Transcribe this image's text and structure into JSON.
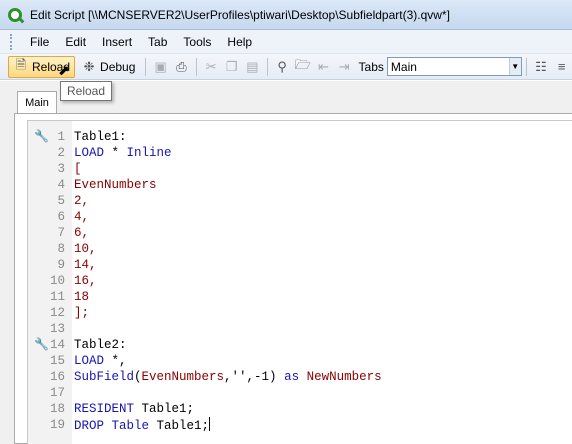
{
  "window": {
    "title": "Edit Script [\\\\MCNSERVER2\\UserProfiles\\ptiwari\\Desktop\\Subfieldpart(3).qvw*]"
  },
  "menu": [
    "File",
    "Edit",
    "Insert",
    "Tab",
    "Tools",
    "Help"
  ],
  "toolbar": {
    "reload_label": "Reload",
    "debug_label": "Debug",
    "tabs_label": "Tabs",
    "tabs_selected": "Main",
    "icons": [
      "save-icon",
      "print-icon",
      "cut-icon",
      "copy-icon",
      "paste-icon",
      "search-icon",
      "folder-icon",
      "outdent-icon",
      "indent-icon",
      "table-viewer-icon",
      "expand-icon"
    ]
  },
  "tooltip": {
    "text": "Reload"
  },
  "tab": {
    "label": "Main"
  },
  "editor": {
    "lines": [
      {
        "n": "1",
        "pin": true,
        "tokens": [
          {
            "t": "Table1:",
            "c": "txt"
          }
        ]
      },
      {
        "n": "2",
        "tokens": [
          {
            "t": "LOAD",
            "c": "kw"
          },
          {
            "t": " * ",
            "c": "txt"
          },
          {
            "t": "Inline",
            "c": "kw"
          }
        ]
      },
      {
        "n": "3",
        "tokens": [
          {
            "t": "[",
            "c": "num"
          }
        ]
      },
      {
        "n": "4",
        "tokens": [
          {
            "t": "EvenNumbers",
            "c": "num"
          }
        ]
      },
      {
        "n": "5",
        "tokens": [
          {
            "t": "2,",
            "c": "num"
          }
        ]
      },
      {
        "n": "6",
        "tokens": [
          {
            "t": "4,",
            "c": "num"
          }
        ]
      },
      {
        "n": "7",
        "tokens": [
          {
            "t": "6,",
            "c": "num"
          }
        ]
      },
      {
        "n": "8",
        "tokens": [
          {
            "t": "10,",
            "c": "num"
          }
        ]
      },
      {
        "n": "9",
        "tokens": [
          {
            "t": "14,",
            "c": "num"
          }
        ]
      },
      {
        "n": "10",
        "tokens": [
          {
            "t": "16,",
            "c": "num"
          }
        ]
      },
      {
        "n": "11",
        "tokens": [
          {
            "t": "18",
            "c": "num"
          }
        ]
      },
      {
        "n": "12",
        "tokens": [
          {
            "t": "];",
            "c": "num"
          }
        ]
      },
      {
        "n": "13",
        "tokens": []
      },
      {
        "n": "14",
        "pin": true,
        "tokens": [
          {
            "t": "Table2:",
            "c": "txt"
          }
        ]
      },
      {
        "n": "15",
        "tokens": [
          {
            "t": "LOAD",
            "c": "kw"
          },
          {
            "t": " *,",
            "c": "txt"
          }
        ]
      },
      {
        "n": "16",
        "tokens": [
          {
            "t": "SubField",
            "c": "fn"
          },
          {
            "t": "(",
            "c": "txt"
          },
          {
            "t": "EvenNumbers",
            "c": "num"
          },
          {
            "t": ",'',-1) ",
            "c": "txt"
          },
          {
            "t": "as",
            "c": "kw"
          },
          {
            "t": " ",
            "c": "txt"
          },
          {
            "t": "NewNumbers",
            "c": "num"
          }
        ]
      },
      {
        "n": "17",
        "tokens": []
      },
      {
        "n": "18",
        "tokens": [
          {
            "t": "RESIDENT",
            "c": "kw"
          },
          {
            "t": " Table1;",
            "c": "txt"
          }
        ]
      },
      {
        "n": "19",
        "caret": true,
        "tokens": [
          {
            "t": "DROP",
            "c": "kw"
          },
          {
            "t": " ",
            "c": "txt"
          },
          {
            "t": "Table",
            "c": "kw"
          },
          {
            "t": " Table1;",
            "c": "txt"
          }
        ]
      }
    ]
  }
}
